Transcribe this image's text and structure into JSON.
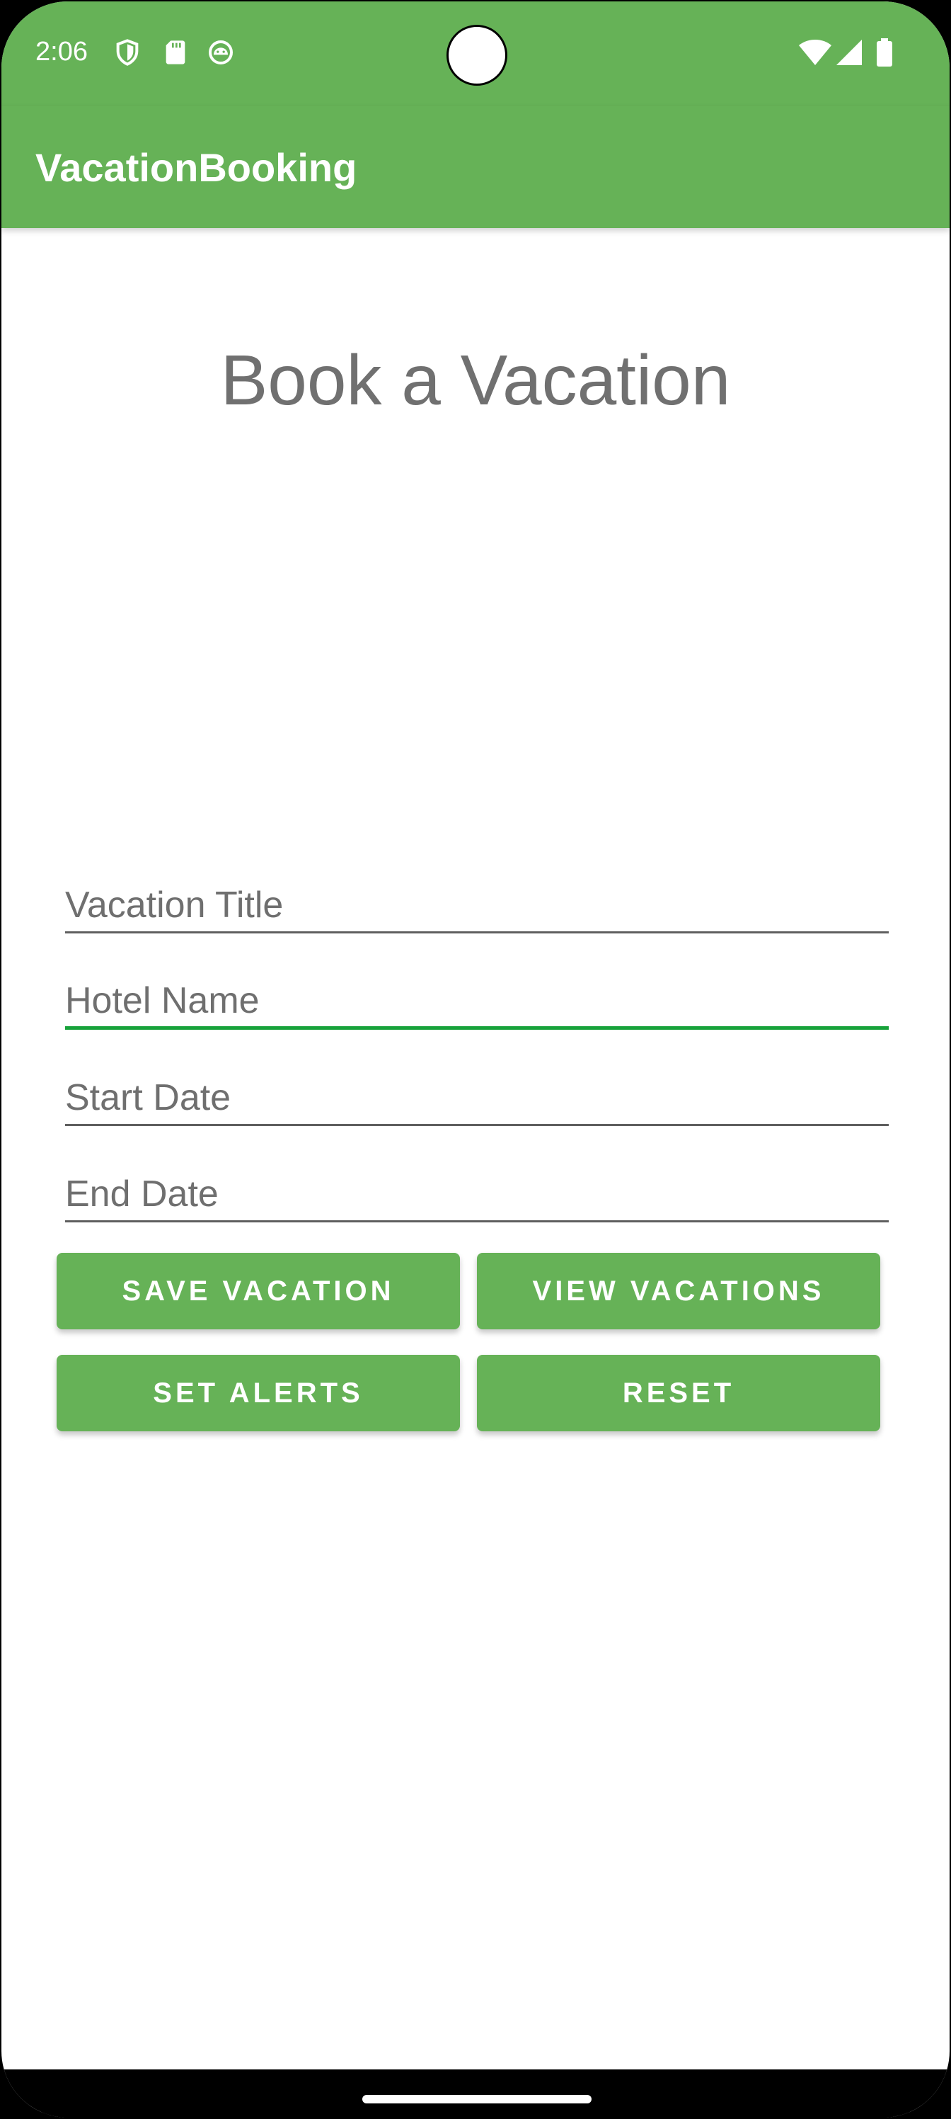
{
  "status_bar": {
    "time": "2:06",
    "left_icons": [
      "shield-icon",
      "sd-card-icon",
      "android-icon"
    ],
    "right_icons": [
      "wifi-icon",
      "cell-signal-icon",
      "battery-icon"
    ]
  },
  "app_bar": {
    "title": "VacationBooking",
    "color": "#66b257"
  },
  "page": {
    "heading": "Book a Vacation"
  },
  "form": {
    "vacation_title": {
      "placeholder": "Vacation Title",
      "value": ""
    },
    "hotel_name": {
      "placeholder": "Hotel Name",
      "value": "",
      "focused": true
    },
    "start_date": {
      "placeholder": "Start Date",
      "value": ""
    },
    "end_date": {
      "placeholder": "End Date",
      "value": ""
    }
  },
  "buttons": {
    "save_vacation": "SAVE VACATION",
    "view_vacations": "VIEW VACATIONS",
    "set_alerts": "SET ALERTS",
    "reset": "RESET"
  },
  "colors": {
    "accent": "#66b257",
    "focus_underline": "#17a23a",
    "heading_text": "#707070"
  }
}
